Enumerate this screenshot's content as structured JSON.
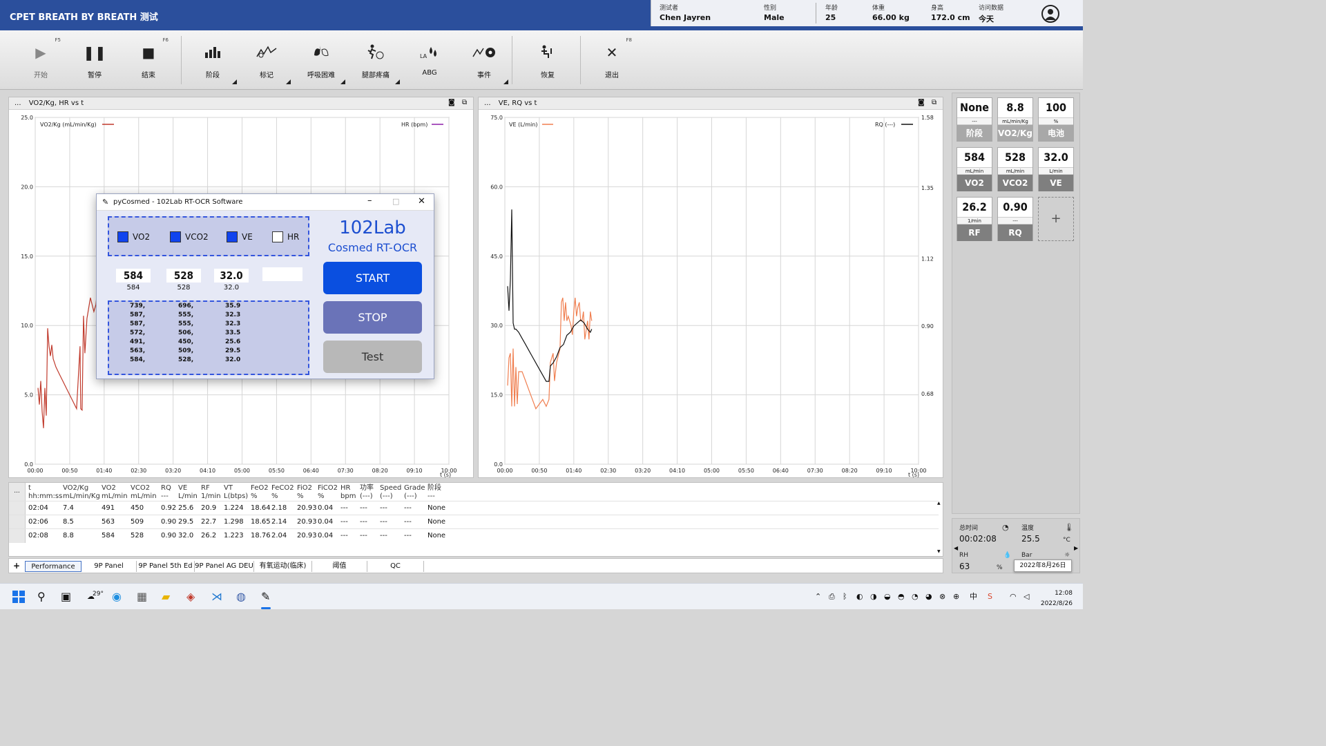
{
  "header": {
    "app_title": "CPET BREATH BY BREATH 测试",
    "patient": {
      "tester_label": "测试者",
      "tester": "Chen Jayren",
      "sex_label": "性别",
      "sex": "Male",
      "age_label": "年龄",
      "age": "25",
      "weight_label": "体重",
      "weight": "66.00 kg",
      "height_label": "身高",
      "height": "172.0 cm",
      "visit_label": "访问数据",
      "visit": "今天"
    }
  },
  "toolbar": {
    "start": {
      "label": "开始",
      "key": "F5"
    },
    "pause": {
      "label": "暂停"
    },
    "stop": {
      "label": "结束",
      "key": "F6"
    },
    "phase": {
      "label": "阶段"
    },
    "marker": {
      "label": "标记"
    },
    "dyspnea": {
      "label": "呼吸困难"
    },
    "leg_pain": {
      "label": "腿部疼痛"
    },
    "abg": {
      "label": "ABG"
    },
    "event": {
      "label": "事件"
    },
    "recovery": {
      "label": "恢复"
    },
    "exit": {
      "label": "退出",
      "key": "F8"
    }
  },
  "chart_left": {
    "title": "VO2/Kg, HR vs t",
    "legend_left": "VO2/Kg (mL/min/Kg)",
    "legend_right": "HR (bpm)",
    "color_vo2": "#c0392b",
    "color_hr": "#8e1fa8",
    "x_axis_label": "t (s)"
  },
  "chart_right": {
    "title": "VE, RQ vs t",
    "legend_left": "VE (L/min)",
    "legend_right": "RQ (---)",
    "color_ve": "#f07e4f",
    "color_rq": "#111111",
    "x_axis_label": "t (s)"
  },
  "chart_data": [
    {
      "type": "line",
      "title": "VO2/Kg, HR vs t",
      "xlabel": "t (s)",
      "x_ticks": [
        "00:00",
        "00:50",
        "01:40",
        "02:30",
        "03:20",
        "04:10",
        "05:00",
        "05:50",
        "06:40",
        "07:30",
        "08:20",
        "09:10",
        "10:00"
      ],
      "xlim": [
        0,
        600
      ],
      "ylim": [
        0,
        25
      ],
      "y_ticks": [
        "0.0",
        "5.0",
        "10.0",
        "15.0",
        "20.0",
        "25.0"
      ],
      "series": [
        {
          "name": "VO2/Kg (mL/min/Kg)",
          "x": [
            4,
            6,
            8,
            10,
            12,
            14,
            16,
            18,
            20,
            22,
            24,
            26,
            30,
            35,
            40,
            45,
            50,
            55,
            60,
            65,
            66,
            68,
            70,
            72,
            75,
            80,
            85,
            88,
            90,
            93,
            96
          ],
          "y": [
            5.5,
            4.3,
            6.0,
            3.8,
            2.6,
            5.5,
            3.5,
            9.8,
            8.5,
            7.8,
            8.6,
            7.6,
            7.0,
            6.5,
            6.0,
            5.5,
            5.0,
            4.5,
            4.0,
            8.5,
            4.0,
            3.9,
            10.7,
            8.0,
            10.5,
            12.0,
            11.0,
            11.5,
            12.5,
            10.2,
            11.4
          ]
        },
        {
          "name": "HR (bpm)",
          "x": [],
          "y": []
        }
      ]
    },
    {
      "type": "line",
      "title": "VE, RQ vs t",
      "xlabel": "t (s)",
      "x_ticks": [
        "00:00",
        "00:50",
        "01:40",
        "02:30",
        "03:20",
        "04:10",
        "05:00",
        "05:50",
        "06:40",
        "07:30",
        "08:20",
        "09:10",
        "10:00"
      ],
      "xlim": [
        0,
        600
      ],
      "ylim_left": [
        0,
        75
      ],
      "y_ticks_left": [
        "0.0",
        "15.0",
        "30.0",
        "45.0",
        "60.0",
        "75.0"
      ],
      "ylim_right": [
        0.45,
        1.58
      ],
      "y_ticks_right": [
        "0.68",
        "0.90",
        "1.12",
        "1.35",
        "1.58"
      ],
      "series": [
        {
          "name": "VE (L/min)",
          "axis": "left",
          "x": [
            4,
            6,
            8,
            10,
            12,
            14,
            16,
            18,
            20,
            25,
            30,
            35,
            40,
            45,
            50,
            55,
            60,
            64,
            66,
            70,
            72,
            75,
            80,
            82,
            84,
            86,
            88,
            90,
            92,
            94,
            96,
            98,
            100,
            102,
            104,
            106,
            108,
            110,
            112,
            114,
            116,
            120,
            122,
            124,
            126
          ],
          "y": [
            17,
            23,
            24,
            12.5,
            25,
            12.5,
            21,
            13,
            20,
            20,
            18,
            16,
            14,
            12,
            13,
            14,
            12.5,
            14,
            22,
            24,
            18,
            22,
            25,
            35,
            36,
            31,
            35,
            31,
            32,
            31,
            30,
            28,
            33,
            36,
            32,
            34,
            35,
            31,
            31,
            33,
            27,
            31,
            27,
            33,
            31
          ]
        },
        {
          "name": "RQ (---)",
          "axis": "right",
          "x": [
            4,
            6,
            8,
            10,
            12,
            14,
            16,
            20,
            25,
            30,
            35,
            40,
            45,
            50,
            55,
            60,
            64,
            66,
            70,
            75,
            80,
            85,
            90,
            95,
            100,
            105,
            110,
            115,
            120,
            124,
            126
          ],
          "y": [
            1.03,
            0.95,
            1.05,
            1.28,
            0.91,
            0.89,
            0.89,
            0.88,
            0.86,
            0.84,
            0.82,
            0.8,
            0.78,
            0.76,
            0.74,
            0.72,
            0.72,
            0.77,
            0.78,
            0.8,
            0.83,
            0.84,
            0.87,
            0.88,
            0.9,
            0.91,
            0.92,
            0.91,
            0.89,
            0.88,
            0.89
          ]
        }
      ]
    }
  ],
  "stats": {
    "tiles": [
      {
        "value": "None",
        "unit": "---",
        "name": "阶段"
      },
      {
        "value": "8.8",
        "unit": "mL/min/Kg",
        "name": "VO2/Kg"
      },
      {
        "value": "100",
        "unit": "%",
        "name": "电池"
      },
      {
        "value": "584",
        "unit": "mL/min",
        "name": "VO2"
      },
      {
        "value": "528",
        "unit": "mL/min",
        "name": "VCO2"
      },
      {
        "value": "32.0",
        "unit": "L/min",
        "name": "VE"
      },
      {
        "value": "26.2",
        "unit": "1/min",
        "name": "RF"
      },
      {
        "value": "0.90",
        "unit": "---",
        "name": "RQ"
      }
    ],
    "add_label": "+"
  },
  "info": {
    "total_time_label": "总时间",
    "total_time": "00:02:08",
    "temp_label": "温度",
    "temp": "25.5",
    "temp_unit": "°C",
    "rh_label": "RH",
    "rh": "63",
    "rh_unit": "%",
    "bar_label": "Bar",
    "date_tooltip": "2022年8月26日"
  },
  "table": {
    "columns": [
      {
        "h1": "t",
        "h2": "hh:mm:ss"
      },
      {
        "h1": "VO2/Kg",
        "h2": "mL/min/Kg"
      },
      {
        "h1": "VO2",
        "h2": "mL/min"
      },
      {
        "h1": "VCO2",
        "h2": "mL/min"
      },
      {
        "h1": "RQ",
        "h2": "---"
      },
      {
        "h1": "VE",
        "h2": "L/min"
      },
      {
        "h1": "RF",
        "h2": "1/min"
      },
      {
        "h1": "VT",
        "h2": "L(btps)"
      },
      {
        "h1": "FeO2",
        "h2": "%"
      },
      {
        "h1": "FeCO2",
        "h2": "%"
      },
      {
        "h1": "FiO2",
        "h2": "%"
      },
      {
        "h1": "FiCO2",
        "h2": "%"
      },
      {
        "h1": "HR",
        "h2": "bpm"
      },
      {
        "h1": "功率",
        "h2": "(---)"
      },
      {
        "h1": "Speed",
        "h2": "(---)"
      },
      {
        "h1": "Grade",
        "h2": "(---)"
      },
      {
        "h1": "阶段",
        "h2": "---"
      }
    ],
    "rows": [
      [
        "02:04",
        "7.4",
        "491",
        "450",
        "0.92",
        "25.6",
        "20.9",
        "1.224",
        "18.64",
        "2.18",
        "20.93",
        "0.04",
        "---",
        "---",
        "---",
        "---",
        "None"
      ],
      [
        "02:06",
        "8.5",
        "563",
        "509",
        "0.90",
        "29.5",
        "22.7",
        "1.298",
        "18.65",
        "2.14",
        "20.93",
        "0.04",
        "---",
        "---",
        "---",
        "---",
        "None"
      ],
      [
        "02:08",
        "8.8",
        "584",
        "528",
        "0.90",
        "32.0",
        "26.2",
        "1.223",
        "18.76",
        "2.04",
        "20.93",
        "0.04",
        "---",
        "---",
        "---",
        "---",
        "None"
      ]
    ]
  },
  "sheet_tabs": {
    "add": "+",
    "items": [
      "Performance",
      "9P Panel",
      "9P Panel 5th Ed",
      "9P Panel AG DEU",
      "有氧运动(临床)",
      "阈值",
      "QC"
    ]
  },
  "dialog": {
    "title": "pyCosmed - 102Lab RT-OCR Software",
    "brand": "102Lab",
    "subtitle": "Cosmed RT-OCR",
    "checks": [
      {
        "label": "VO2",
        "checked": true
      },
      {
        "label": "VCO2",
        "checked": true
      },
      {
        "label": "VE",
        "checked": true
      },
      {
        "label": "HR",
        "checked": false
      }
    ],
    "values": [
      {
        "big": "584",
        "small": "584"
      },
      {
        "big": "528",
        "small": "528"
      },
      {
        "big": "32.0",
        "small": "32.0"
      },
      {
        "big": "",
        "small": ""
      }
    ],
    "history": {
      "vo2": [
        "739,",
        "587,",
        "587,",
        "572,",
        "491,",
        "563,",
        "584,"
      ],
      "vco2": [
        "696,",
        "555,",
        "555,",
        "506,",
        "450,",
        "509,",
        "528,"
      ],
      "ve": [
        "35.9",
        "32.3",
        "32.3",
        "33.5",
        "25.6",
        "29.5",
        "32.0"
      ]
    },
    "buttons": {
      "start": "START",
      "stop": "STOP",
      "test": "Test"
    },
    "colors": {
      "start": "#0a4fe0",
      "stop": "#6a73b8",
      "test": "#b8b8b8"
    }
  },
  "taskbar": {
    "weather": "29°",
    "clock_time": "12:08",
    "clock_date": "2022/8/26",
    "ime": "中"
  }
}
